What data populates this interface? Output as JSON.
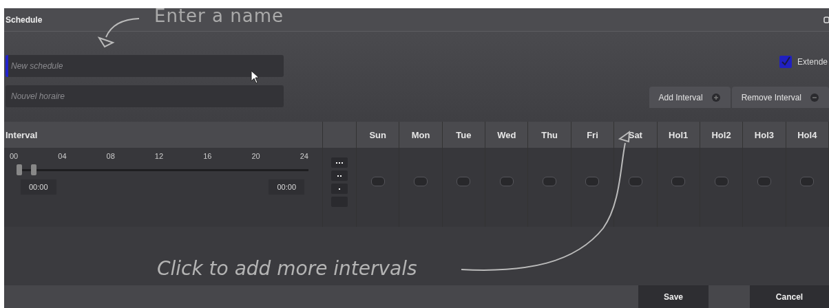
{
  "window": {
    "title": "Schedule"
  },
  "annotations": [
    {
      "kind": "name",
      "text": "Enter a name"
    },
    {
      "kind": "interval",
      "text": "Click to add more intervals"
    }
  ],
  "name_fields": [
    {
      "placeholder": "New schedule",
      "focused": true
    },
    {
      "placeholder": "Nouvel horaire",
      "focused": false
    }
  ],
  "extended": {
    "label": "Extende",
    "checked": true
  },
  "interval_buttons": [
    {
      "label": "Add Interval",
      "kind": "add"
    },
    {
      "label": "Remove Interval",
      "kind": "remove"
    }
  ],
  "table": {
    "interval_heading": "Interval",
    "ticks": [
      "00",
      "04",
      "08",
      "12",
      "16",
      "20",
      "24"
    ],
    "thumbs": [
      {
        "level": 0
      },
      {
        "level": 0.05
      }
    ],
    "start_time": "00:00",
    "end_time": "00:00",
    "pattern_buttons": [
      {
        "kind": "three"
      },
      {
        "kind": "two"
      },
      {
        "kind": "one"
      },
      {
        "kind": "none"
      }
    ],
    "days": [
      {
        "label": "Sun",
        "on": false
      },
      {
        "label": "Mon",
        "on": false
      },
      {
        "label": "Tue",
        "on": false
      },
      {
        "label": "Wed",
        "on": false
      },
      {
        "label": "Thu",
        "on": false
      },
      {
        "label": "Fri",
        "on": false
      },
      {
        "label": "Sat",
        "on": false
      },
      {
        "label": "Hol1",
        "on": false
      },
      {
        "label": "Hol2",
        "on": false
      },
      {
        "label": "Hol3",
        "on": false
      },
      {
        "label": "Hol4",
        "on": false
      }
    ]
  },
  "buttons": [
    {
      "label": "Save"
    },
    {
      "label": "Cancel"
    }
  ]
}
